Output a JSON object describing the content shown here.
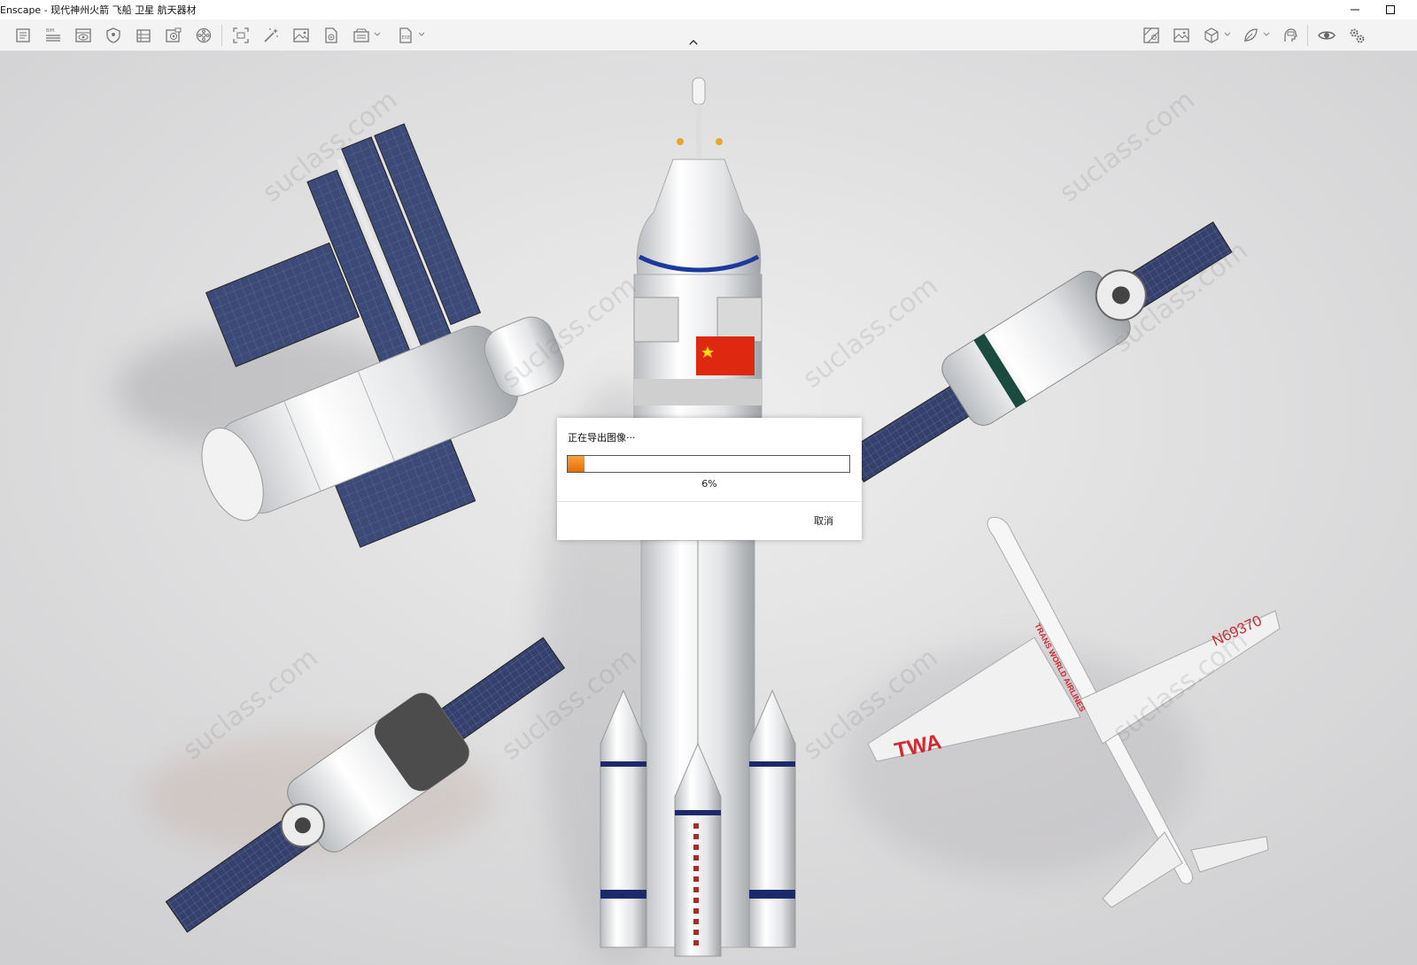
{
  "window": {
    "title": "Enscape - 现代神州火箭 飞船 卫星 航天器材",
    "minimize_icon": "minimize-icon",
    "maximize_icon": "maximize-icon"
  },
  "toolbar": {
    "left_icons": [
      "document-icon",
      "bim-list-icon",
      "view-icon",
      "shield-icon",
      "building-icon",
      "video-icon",
      "asset-wheel-icon",
      "capture-icon",
      "magic-wand-icon",
      "image-icon",
      "document-settings-icon",
      "batch-render-icon",
      "export-icon"
    ],
    "right_icons": [
      "map-icon",
      "gallery-icon",
      "cube-icon",
      "feather-icon",
      "vr-headset-icon",
      "eye-icon",
      "settings-gears-icon"
    ],
    "collapse_icon": "chevron-up-icon"
  },
  "scene": {
    "watermark_text": "suclass.com",
    "aircraft_livery": "TWA",
    "aircraft_registration": "N69370",
    "aircraft_fuselage_text": "TRANS WORLD AIRLINES"
  },
  "export_dialog": {
    "message": "正在导出图像···",
    "progress_fraction": 0.06,
    "progress_label": "6%",
    "cancel_label": "取消"
  },
  "colors": {
    "progress_orange": "#f08a1e",
    "solar_panel_blue": "#3a4a7a",
    "flag_red": "#de2910",
    "twa_red": "#d8262d"
  }
}
